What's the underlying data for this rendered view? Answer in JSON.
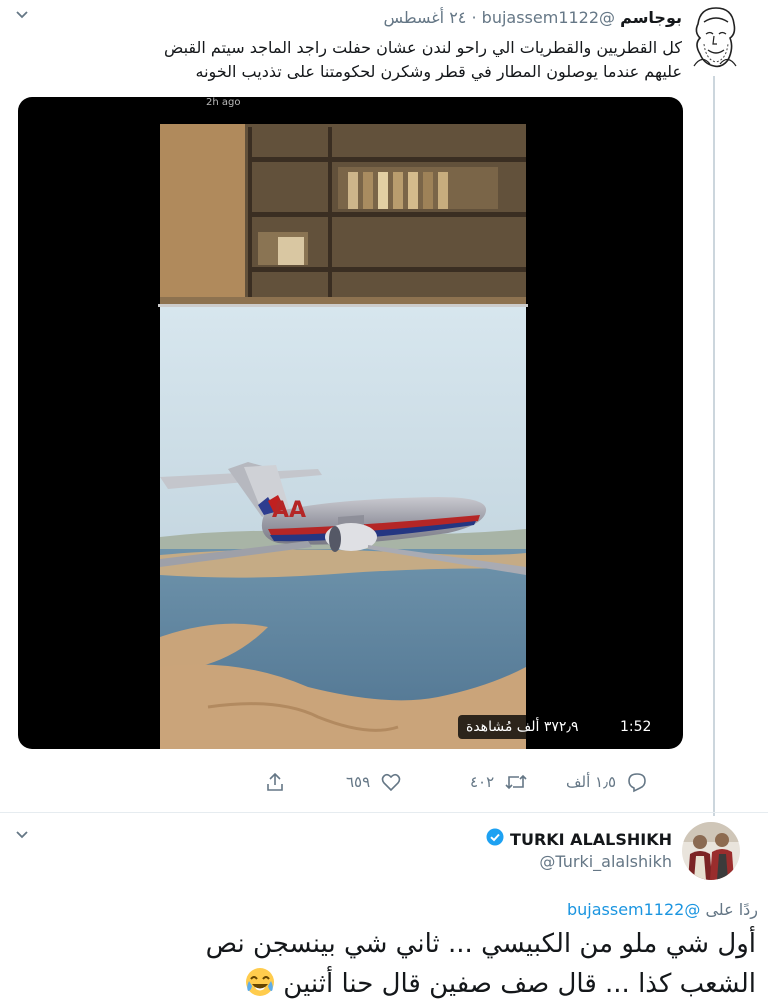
{
  "tweet": {
    "author_name": "بوجاسم",
    "author_handle": "@bujassem1122",
    "separator": "·",
    "date": "٢٤ أغسطس",
    "text_line1": "كل القطريين والقطريات الي راحو لندن عشان حفلت راجد الماجد سيتم القبض",
    "text_line2": "عليهم عندما يوصلون المطار في قطر وشكرن لحكومتنا على تذديب الخونه",
    "media": {
      "snap_timestamp": "2h ago",
      "duration": "1:52",
      "views": "٣٧٢٫٩ ألف مُشاهدة",
      "livery": "AA"
    },
    "actions": {
      "reply_count": "١٫٥ ألف",
      "retweet_count": "٤٠٢",
      "like_count": "٦٥٩"
    }
  },
  "reply": {
    "author_name": "TURKI ALALSHIKH",
    "author_handle": "@Turki_alalshikh",
    "verified": true,
    "replying_to_label": "ردًا على",
    "replying_to_handle": "@bujassem1122",
    "text_line1": "أول شي ملو من الكبيسي ... ثاني شي بينسجن نص",
    "text_line2": "الشعب كذا ... قال صف صفين قال حنا أثنين",
    "emoji": "face-with-tears-of-joy"
  },
  "colors": {
    "link": "#1b95e0",
    "secondary_text": "#657786",
    "verified": "#1da1f2",
    "divider": "#e6ecf0"
  }
}
